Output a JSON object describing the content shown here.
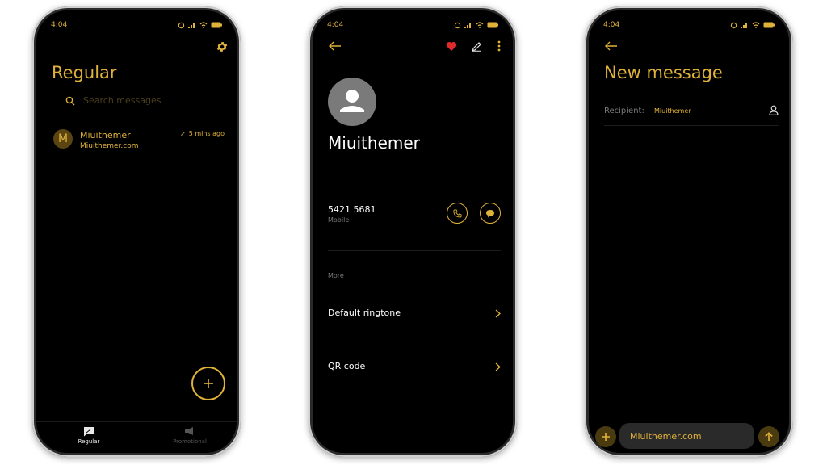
{
  "colors": {
    "accent": "#e0b23a",
    "screen_bg": "#000000",
    "text": "#ffffff",
    "muted": "#7a7a7a"
  },
  "status": {
    "time": "4:04"
  },
  "phone1": {
    "title": "Regular",
    "search_placeholder": "Search messages",
    "conversation": {
      "avatar_letter": "M",
      "name": "Miuithemer",
      "preview": "Miuithemer.com",
      "time": "5 mins ago"
    },
    "tabs": [
      {
        "label": "Regular",
        "icon": "chat-icon"
      },
      {
        "label": "Promotional",
        "icon": "megaphone-icon"
      }
    ]
  },
  "phone2": {
    "contact_name": "Miuithemer",
    "phone_number": "5421 5681",
    "phone_type": "Mobile",
    "section_label": "More",
    "menu": [
      {
        "label": "Default ringtone"
      },
      {
        "label": "QR code"
      }
    ]
  },
  "phone3": {
    "title": "New message",
    "recipient_label": "Recipient:",
    "recipient_value": "Miuithemer",
    "compose_text": "Miuithemer.com"
  }
}
